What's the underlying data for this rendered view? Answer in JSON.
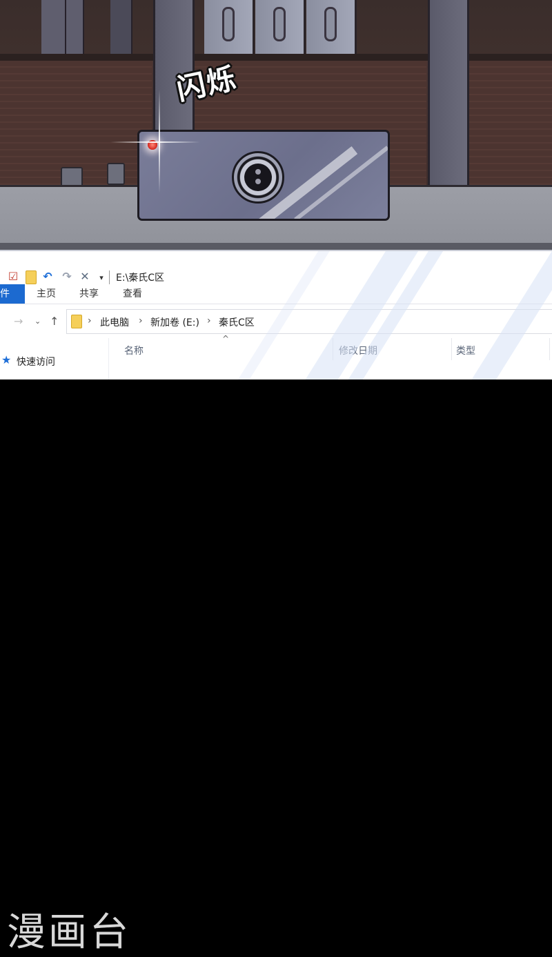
{
  "comic": {
    "sound_effect": "闪烁"
  },
  "explorer": {
    "title_path": "E:\\秦氏C区",
    "quick_access_icons": [
      "properties-icon",
      "new-folder-icon",
      "undo-icon",
      "redo-icon",
      "delete-icon",
      "customize-dropdown-icon"
    ],
    "ribbon_tabs": [
      {
        "label": "文件",
        "shown": "文件"
      },
      {
        "label": "主页"
      },
      {
        "label": "共享"
      },
      {
        "label": "查看"
      }
    ],
    "breadcrumb": [
      "此电脑",
      "新加卷 (E:)",
      "秦氏C区"
    ],
    "columns": [
      "名称",
      "修改日期",
      "类型"
    ],
    "nav_pane": {
      "quick_access": "快速访问"
    }
  },
  "watermark": "漫画台",
  "colors": {
    "file_tab": "#1c6ad0",
    "led": "#d4241a",
    "webcam_body": "#7a7d99"
  }
}
